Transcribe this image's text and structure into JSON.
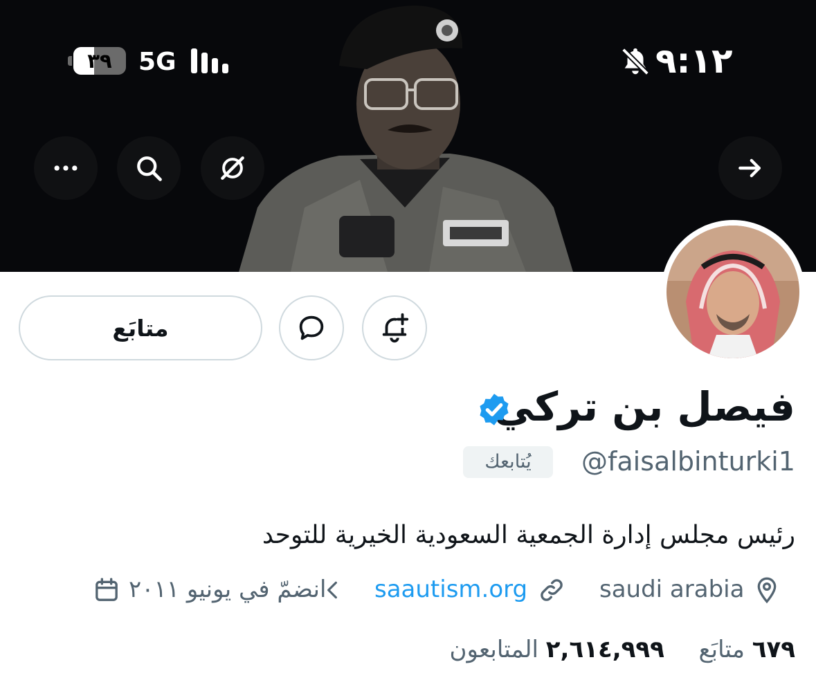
{
  "status_bar": {
    "time": "٩:١٢",
    "battery_level": 39,
    "battery_text": "٣٩",
    "network": "5G"
  },
  "banner": {
    "back_icon": "arrow-right-icon",
    "grok_icon": "grok-icon",
    "search_icon": "search-icon",
    "more_icon": "more-icon"
  },
  "profile": {
    "display_name": "فيصل بن تركي",
    "verified": true,
    "handle": "@faisalbinturki1",
    "follows_you": "يُتابعك",
    "bio": "رئيس مجلس إدارة الجمعية السعودية الخيرية للتوحد",
    "location": "saudi arabia",
    "website": "saautism.org",
    "joined": "انضمّ في يونيو ٢٠١١",
    "following_count": "٦٧٩",
    "following_label": "متابَع",
    "followers_count": "٢,٦١٤,٩٩٩",
    "followers_label": "المتابعون"
  },
  "actions": {
    "following_button": "متابَع"
  },
  "colors": {
    "link": "#1d9bf0",
    "verified": "#1d9bf0",
    "secondary_text": "#536471",
    "border": "#cfd9de"
  }
}
